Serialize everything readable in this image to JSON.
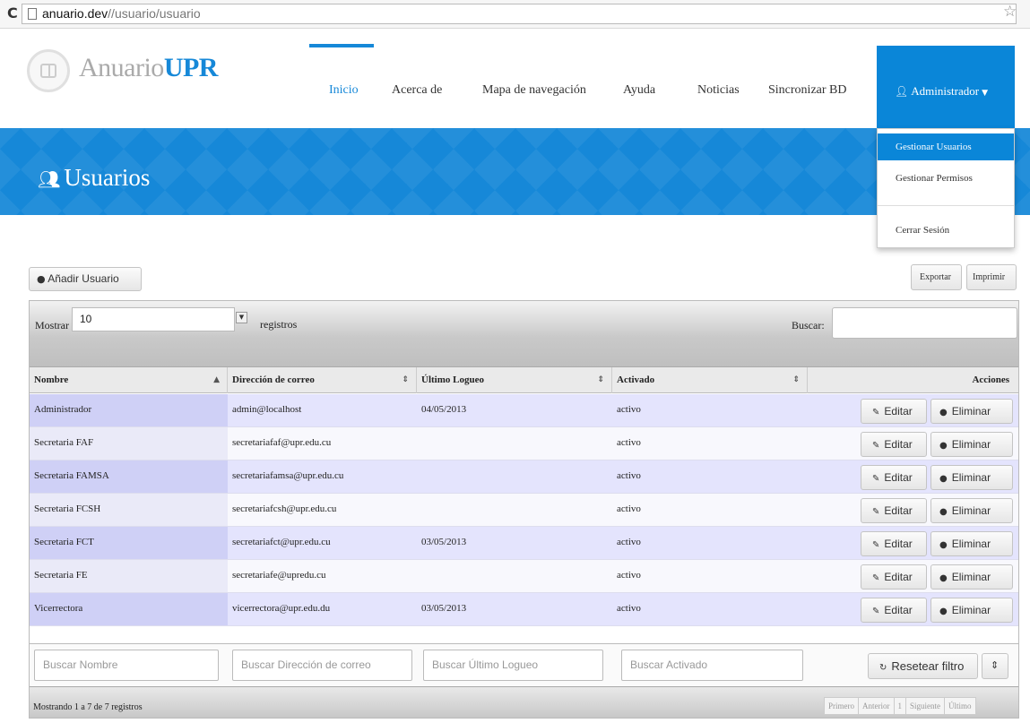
{
  "browser": {
    "url_host": "anuario.dev",
    "url_path": "//usuario/usuario"
  },
  "logo": {
    "text_a": "Anuario",
    "text_b": "UPR"
  },
  "nav": {
    "items": [
      "Inicio",
      "Acerca de",
      "Mapa de navegación",
      "Ayuda",
      "Noticias",
      "Sincronizar BD"
    ],
    "active": "Inicio",
    "user_menu": "Administrador"
  },
  "dropdown": {
    "items": [
      "Gestionar Usuarios",
      "Gestionar Permisos",
      "Cerrar Sesión"
    ],
    "highlighted": "Gestionar Usuarios"
  },
  "page": {
    "title": "Usuarios"
  },
  "toolbar": {
    "add_label": "Añadir Usuario",
    "export_label": "Exportar",
    "print_label": "Imprimir"
  },
  "table_controls": {
    "show_label": "Mostrar",
    "show_value": "10",
    "records_label": "registros",
    "search_label": "Buscar:"
  },
  "table": {
    "columns": [
      "Nombre",
      "Dirección de correo",
      "Último Logueo",
      "Activado",
      "Acciones"
    ],
    "rows": [
      {
        "name": "Administrador",
        "email": "admin@localhost",
        "last_login": "04/05/2013",
        "active": "activo"
      },
      {
        "name": "Secretaria FAF",
        "email": "secretariafaf@upr.edu.cu",
        "last_login": "",
        "active": "activo"
      },
      {
        "name": "Secretaria FAMSA",
        "email": "secretariafamsa@upr.edu.cu",
        "last_login": "",
        "active": "activo"
      },
      {
        "name": "Secretaria FCSH",
        "email": "secretariafcsh@upr.edu.cu",
        "last_login": "",
        "active": "activo"
      },
      {
        "name": "Secretaria FCT",
        "email": "secretariafct@upr.edu.cu",
        "last_login": "03/05/2013",
        "active": "activo"
      },
      {
        "name": "Secretaria FE",
        "email": "secretariafe@upredu.cu",
        "last_login": "",
        "active": "activo"
      },
      {
        "name": "Vicerrectora",
        "email": "vicerrectora@upr.edu.du",
        "last_login": "03/05/2013",
        "active": "activo"
      }
    ],
    "edit_label": "Editar",
    "delete_label": "Eliminar"
  },
  "filters": {
    "name_placeholder": "Buscar Nombre",
    "email_placeholder": "Buscar Dirección de correo",
    "login_placeholder": "Buscar Último Logueo",
    "active_placeholder": "Buscar Activado",
    "reset_label": "Resetear filtro"
  },
  "footer": {
    "info": "Mostrando 1 a 7 de 7 registros",
    "pager": [
      "Primero",
      "Anterior",
      "1",
      "Siguiente",
      "Último"
    ]
  },
  "colors": {
    "accent": "#1688d8",
    "row_odd": "#e4e4fd",
    "row_even": "#f8f8fd"
  }
}
